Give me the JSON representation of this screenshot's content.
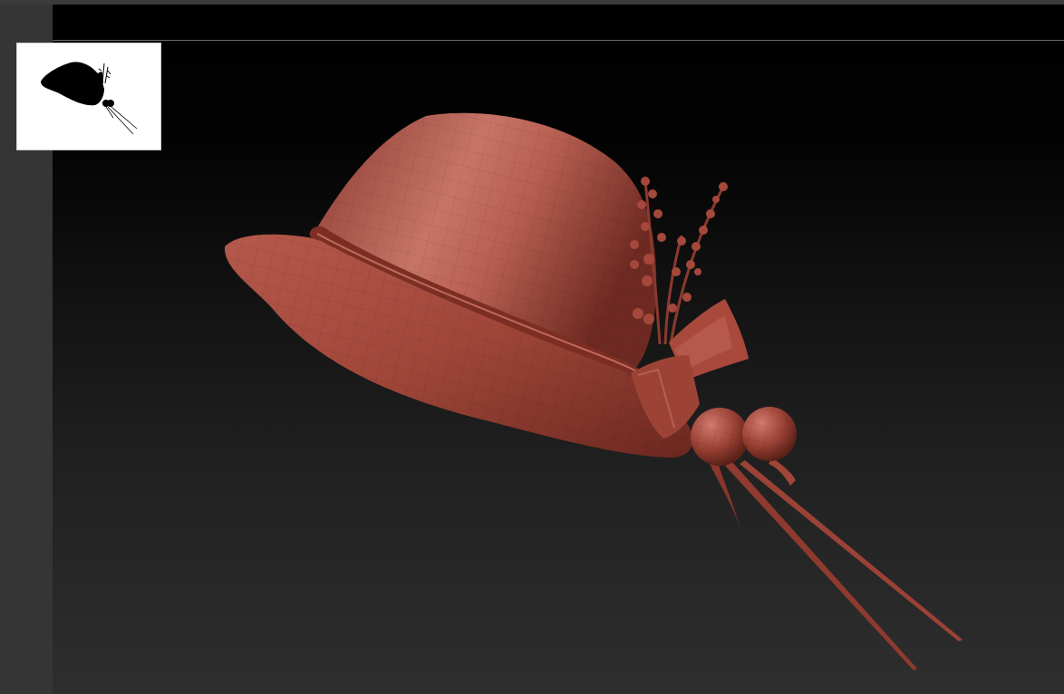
{
  "viewport": {
    "background_top": "#000000",
    "background_bottom": "#2e2e2e"
  },
  "navigator": {
    "background": "#ffffff",
    "silhouette_color": "#000000"
  },
  "model": {
    "icon": "hat-model",
    "material_color": "#a5483c",
    "highlight_color": "#d88a7d",
    "shadow_color": "#5a1f18"
  }
}
